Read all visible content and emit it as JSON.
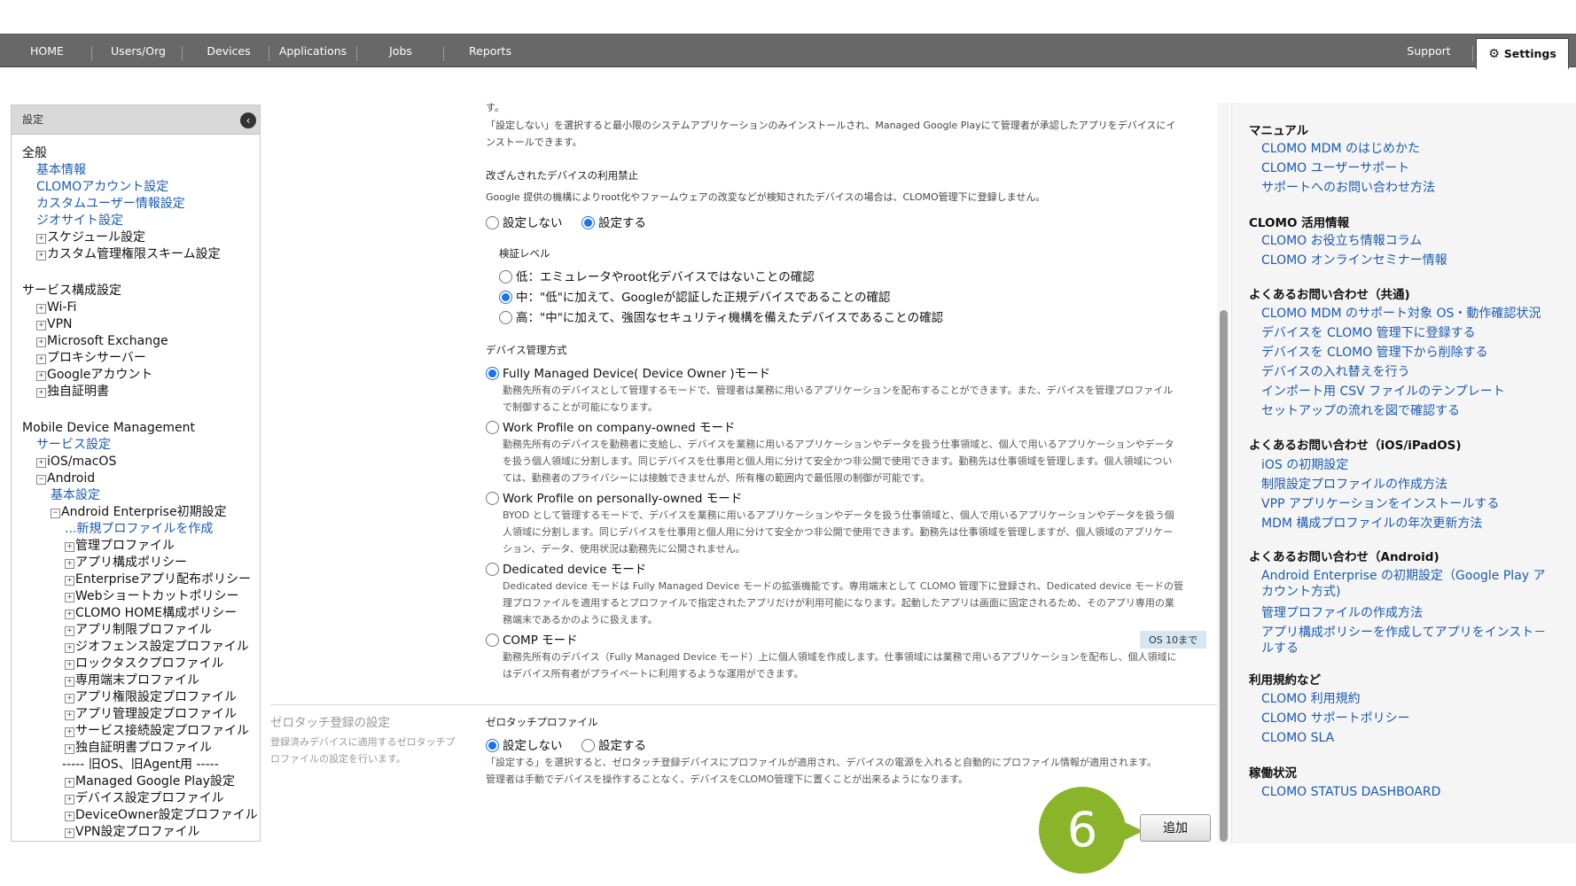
{
  "nav": {
    "items": [
      "HOME",
      "Users/Org",
      "Devices",
      "Applications",
      "Jobs",
      "Reports"
    ],
    "support": "Support",
    "settings": "Settings"
  },
  "sidebar": {
    "title": "設定",
    "general_heading": "全般",
    "general_items": [
      "基本情報",
      "CLOMOアカウント設定",
      "カスタムユーザー情報設定",
      "ジオサイト設定"
    ],
    "general_expand": [
      "スケジュール設定",
      "カスタム管理権限スキーム設定"
    ],
    "service_heading": "サービス構成設定",
    "service_items": [
      "Wi-Fi",
      "VPN",
      "Microsoft Exchange",
      "プロキシサーバー",
      "Googleアカウント",
      "独自証明書"
    ],
    "mdm_heading": "Mobile Device Management",
    "mdm_service": "サービス設定",
    "ios": "iOS/macOS",
    "android": "Android",
    "android_basic": "基本設定",
    "ae_initial": "Android Enterprise初期設定",
    "new_profile": "...新規プロファイルを作成",
    "profiles": [
      "管理プロファイル",
      "アプリ構成ポリシー",
      "Enterpriseアプリ配布ポリシー",
      "Webショートカットポリシー",
      "CLOMO HOME構成ポリシー",
      "アプリ制限プロファイル",
      "ジオフェンス設定プロファイル",
      "ロックタスクプロファイル",
      "専用端末プロファイル",
      "アプリ権限設定プロファイル",
      "アプリ管理設定プロファイル",
      "サービス接続設定プロファイル",
      "独自証明書プロファイル"
    ],
    "legacy_sep": "----- 旧OS、旧Agent用 -----",
    "legacy": [
      "Managed Google Play設定",
      "デバイス設定プロファイル",
      "DeviceOwner設定プロファイル",
      "VPN設定プロファイル"
    ]
  },
  "main": {
    "top_text1": "す。",
    "top_text2": "「設定しない」を選択すると最小限のシステムアプリケーションのみインストールされ、Managed Google Playにて管理者が承認したアプリをデバイスにイ",
    "top_text3": "ンストールできます。",
    "tamper_label": "改ざんされたデバイスの利用禁止",
    "tamper_desc": "Google 提供の機構によりroot化やファームウェアの改変などが検知されたデバイスの場合は、CLOMO管理下に登録しません。",
    "tamper_off": "設定しない",
    "tamper_on": "設定する",
    "verify_label": "検証レベル",
    "verify_low": "低：エミュレータやroot化デバイスではないことの確認",
    "verify_mid": "中：\"低\"に加えて、Googleが認証した正規デバイスであることの確認",
    "verify_high": "高：\"中\"に加えて、強固なセキュリティ機構を備えたデバイスであることの確認",
    "mgmt_label": "デバイス管理方式",
    "fmd_title": "Fully Managed Device( Device Owner )モード",
    "fmd_d1": "勤務先所有のデバイスとして管理するモードで、管理者は業務に用いるアプリケーションを配布することができます。また、デバイスを管理プロファイル",
    "fmd_d2": "で制御することが可能になります。",
    "wpc_title": "Work Profile on company-owned モード",
    "wpc_d1": "勤務先所有のデバイスを勤務者に支給し、デバイスを業務に用いるアプリケーションやデータを扱う仕事領域と、個人で用いるアプリケーションやデータ",
    "wpc_d2": "を扱う個人領域に分割します。同じデバイスを仕事用と個人用に分けて安全かつ非公開で使用できます。勤務先は仕事領域を管理します。個人領域につい",
    "wpc_d3": "ては、勤務者のプライバシーには接触できませんが、所有権の範囲内で最低限の制御が可能です。",
    "wpp_title": "Work Profile on personally-owned モード",
    "wpp_d1": "BYOD として管理するモードで、デバイスを業務に用いるアプリケーションやデータを扱う仕事領域と、個人で用いるアプリケーションやデータを扱う個",
    "wpp_d2": "人領域に分割します。同じデバイスを仕事用と個人用に分けて安全かつ非公開で使用できます。勤務先は仕事領域を管理しますが、個人領域のアプリケー",
    "wpp_d3": "ション、データ、使用状況は勤務先に公開されません。",
    "ded_title": "Dedicated device モード",
    "ded_d1": "Dedicated device モードは Fully Managed Device モードの拡張機能です。専用端末として CLOMO 管理下に登録され、Dedicated device モードの管",
    "ded_d2": "理プロファイルを適用するとプロファイルで指定されたアプリだけが利用可能になります。起動したアプリは画面に固定されるため、そのアプリ専用の業",
    "ded_d3": "務端末であるかのように扱えます。",
    "comp_title": "COMP モード",
    "comp_badge": "OS 10まで",
    "comp_d1": "勤務先所有のデバイス（Fully Managed Device モード）上に個人領域を作成します。仕事領域には業務で用いるアプリケーションを配布し、個人領域に",
    "comp_d2": "はデバイス所有者がプライベートに利用するような運用ができます。",
    "zt_section": "ゼロタッチ登録の設定",
    "zt_section_d1": "登録済みデバイスに適用するゼロタッチプ",
    "zt_section_d2": "ロファイルの設定を行います。",
    "zt_label": "ゼロタッチプロファイル",
    "zt_off": "設定しない",
    "zt_on": "設定する",
    "zt_d1": "「設定する」を選択すると、ゼロタッチ登録デバイスにプロファイルが適用され、デバイスの電源を入れると自動的にプロファイル情報が適用されます。",
    "zt_d2": "管理者は手動でデバイスを操作することなく、デバイスをCLOMO管理下に置くことが出来るようになります。",
    "add_button": "追加",
    "step_number": "6"
  },
  "right": {
    "manual": "マニュアル",
    "manual_links": [
      "CLOMO MDM のはじめかた",
      "CLOMO ユーザーサポート",
      "サポートへのお問い合わせ方法"
    ],
    "info": "CLOMO 活用情報",
    "info_links": [
      "CLOMO お役立ち情報コラム",
      "CLOMO オンラインセミナー情報"
    ],
    "faq_common": "よくあるお問い合わせ（共通)",
    "faq_common_links": [
      "CLOMO MDM のサポート対象 OS・動作確認状況",
      "デバイスを CLOMO 管理下に登録する",
      "デバイスを CLOMO 管理下から削除する",
      "デバイスの入れ替えを行う",
      "インポート用 CSV ファイルのテンプレート",
      "セットアップの流れを図で確認する"
    ],
    "faq_ios": "よくあるお問い合わせ（iOS/iPadOS)",
    "faq_ios_links": [
      "iOS の初期設定",
      "制限設定プロファイルの作成方法",
      "VPP アプリケーションをインストールする",
      "MDM 構成プロファイルの年次更新方法"
    ],
    "faq_android": "よくあるお問い合わせ（Android)",
    "faq_android_links": [
      "Android Enterprise の初期設定（Google Play ア カウント方式)",
      "管理プロファイルの作成方法",
      "アプリ構成ポリシーを作成してアプリをインスト－ルする"
    ],
    "terms": "利用規約など",
    "terms_links": [
      "CLOMO 利用規約",
      "CLOMO サポートポリシー",
      "CLOMO SLA"
    ],
    "status": "稼働状況",
    "status_links": [
      "CLOMO STATUS DASHBOARD"
    ]
  },
  "colors": {
    "nav_bg": "#686868",
    "link": "#1a5bb5",
    "radio_on": "#1a73e8",
    "step_badge": "#8ab52a"
  }
}
